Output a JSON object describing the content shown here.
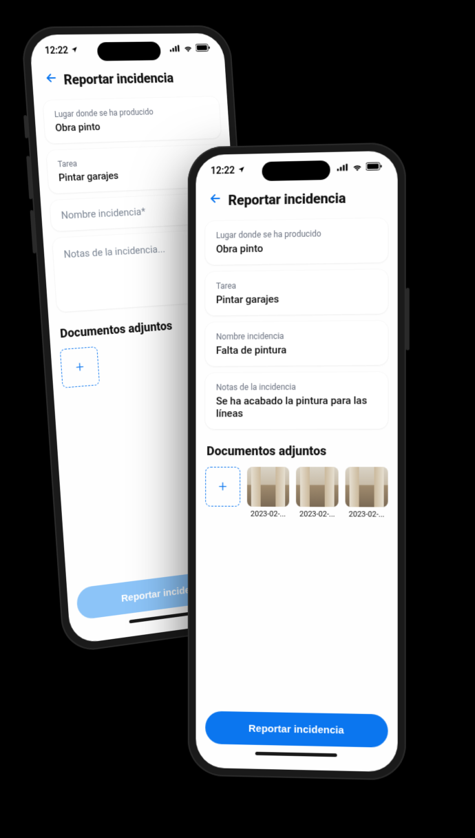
{
  "status": {
    "time": "12:22"
  },
  "header": {
    "title": "Reportar incidencia"
  },
  "fields": {
    "lugar_label": "Lugar donde se ha producido",
    "lugar_value": "Obra pinto",
    "tarea_label": "Tarea",
    "tarea_value": "Pintar garajes",
    "nombre_label": "Nombre incidencia",
    "nombre_placeholder": "Nombre incidencia*",
    "nombre_value": "Falta de pintura",
    "notas_label": "Notas de la incidencia",
    "notas_placeholder": "Notas de la incidencia...",
    "notas_value": "Se ha acabado la pintura para las líneas"
  },
  "attachments": {
    "section_title": "Documentos adjuntos",
    "items": [
      {
        "name": "2023-02-..."
      },
      {
        "name": "2023-02-..."
      },
      {
        "name": "2023-02-..."
      }
    ]
  },
  "submit": {
    "label": "Reportar incidencia"
  }
}
